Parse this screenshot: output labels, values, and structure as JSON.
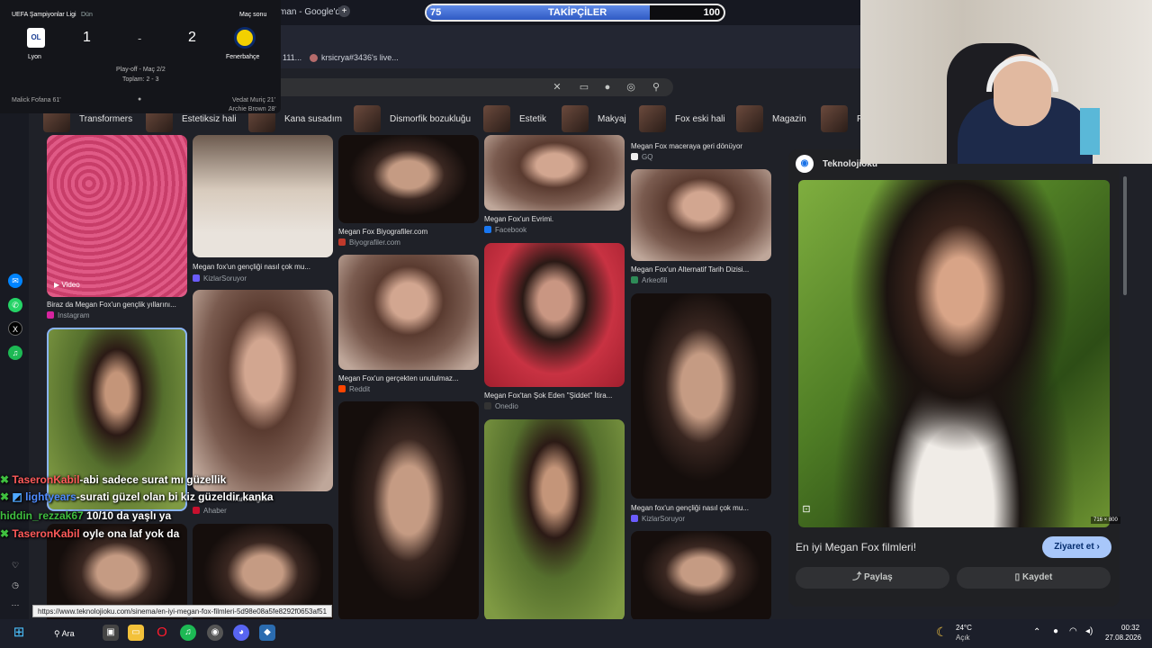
{
  "browser": {
    "tab_title": "man - Google'd",
    "bookmarks": [
      "111...",
      "krsicrya#3436's live..."
    ]
  },
  "chips": [
    "Transformers",
    "Estetiksiz hali",
    "Kana susadım",
    "Dismorfik bozukluğu",
    "Estetik",
    "Makyaj",
    "Fox eski hali",
    "Magazin",
    "P"
  ],
  "results": [
    {
      "caption": "Biraz da Megan Fox'un gençlik yıllarını...",
      "source": "Instagram",
      "badge": "Video"
    },
    {
      "caption": "Megan fox'un gençliği nasıl çok mu...",
      "source": "KizlarSoruyor"
    },
    {
      "caption": "Megan Fox Biyografiler.com",
      "source": "Biyografiler.com"
    },
    {
      "caption": "Megan Fox'un gerçekten unutulmaz...",
      "source": "Reddit"
    },
    {
      "caption": "Megan Fox'un Evrimi.",
      "source": "Facebook"
    },
    {
      "caption": "Megan Fox'tan Şok Eden \"Şiddet\" İtira...",
      "source": "Onedio"
    },
    {
      "caption": "Megan Fox maceraya geri dönüyor",
      "source": "GQ"
    },
    {
      "caption": "Megan Fox'un Alternatif Tarih Dizisi...",
      "source": "Arkeofili"
    },
    {
      "caption": "Megan fox'un gençliği nasıl çok mu...",
      "source": "KizlarSoruyor"
    },
    {
      "caption": "...rarlı bilgiler",
      "source": "Ahaber"
    }
  ],
  "preview": {
    "source": "Teknolojioku",
    "dimensions": "716 × 800",
    "title": "En iyi Megan Fox filmleri!",
    "visit_label": "Ziyaret et",
    "share_label": "Paylaş",
    "save_label": "Kaydet"
  },
  "score": {
    "league": "UEFA Şampiyonlar Ligi",
    "when": "Dün",
    "status": "Maç sonu",
    "home": "Lyon",
    "away": "Fenerbahçe",
    "home_score": "1",
    "away_score": "2",
    "dash": "-",
    "round": "Play-off - Maç 2/2",
    "aggregate": "Toplam: 2 - 3",
    "home_scorer": "Malick Fofana 61'",
    "away_scorer1": "Vedat Muriç 21'",
    "away_scorer2": "Archie Brown 28'"
  },
  "followers": {
    "label": "TAKİPÇİLER",
    "current": "75",
    "goal": "100",
    "progress": 0.75
  },
  "chat": [
    {
      "user": "TaseronKabil",
      "msg": "abi sadece surat mı güzellik"
    },
    {
      "user": "lightyears",
      "msg": "surati güzel olan bi kiz güzeldir kanka"
    },
    {
      "user": "hiddin_rezzak67",
      "msg": "10/10 da yaşlı ya"
    },
    {
      "user": "TaseronKabil",
      "msg": "oyle ona laf yok da"
    }
  ],
  "status_url": "https://www.teknolojioku.com/sinema/en-iyi-megan-fox-filmleri-5d98e08a5fe8292f0653af51",
  "taskbar": {
    "search_label": "Ara",
    "weather_temp": "24°C",
    "weather_desc": "Açık",
    "time": "00:32",
    "date": "27.08.2026"
  },
  "colors": {
    "accent": "#a8c7fa",
    "panel": "#202124",
    "chat_user": "#ff6b6b",
    "chat_user_alt": "#4f8cff"
  }
}
